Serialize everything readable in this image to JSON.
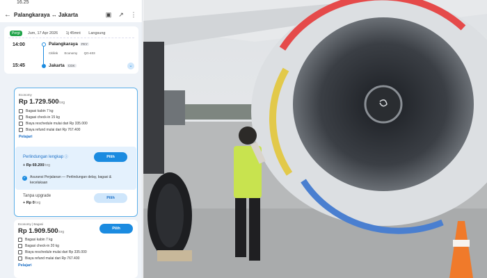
{
  "status": {
    "time": "16.25"
  },
  "header": {
    "title": "Palangkaraya ↔ Jakarta"
  },
  "flight": {
    "tag": "Pergi",
    "date": "Jum, 17 Apr 2026",
    "duration": "1j 45mnt",
    "type": "Langsung",
    "depart_time": "14:00",
    "depart_city": "Palangkaraya",
    "depart_code": "PKY",
    "airline": "Citilink",
    "class": "Economy",
    "flight_no": "QG-403",
    "arrive_time": "15:45",
    "arrive_city": "Jakarta",
    "arrive_code": "CGK"
  },
  "offers": [
    {
      "type": "Economy",
      "price": "Rp 1.729.500",
      "unit": "/org",
      "features": [
        "Bagasi kabin 7 kg",
        "Bagasi check-in 15 kg",
        "Biaya reschedule mulai dari Rp 335.000",
        "Biaya refund mulai dari Rp 767.400"
      ],
      "learn": "Pelajari",
      "protection": {
        "title": "Perlindungan lengkap",
        "price": "+ Rp 69.200",
        "unit": "/org",
        "button": "Pilih",
        "desc": "Asuransi Perjalanan — Perlindungan delay, bagasi & kecelakaan"
      },
      "no_upgrade": {
        "title": "Tanpa upgrade",
        "price": "+ Rp 0",
        "unit": "/org",
        "button": "Pilih"
      }
    },
    {
      "type": "Economy | Bagasi",
      "price": "Rp 1.909.500",
      "unit": "/org",
      "button": "Pilih",
      "features": [
        "Bagasi kabin 7 kg",
        "Bagasi check-in 20 kg",
        "Biaya reschedule mulai dari Rp 335.000",
        "Biaya refund mulai dari Rp 767.400"
      ],
      "learn": "Pelajari"
    }
  ],
  "icons": [
    "back-arrow-icon",
    "save-icon",
    "share-icon",
    "more-icon",
    "chevron-down-icon",
    "info-icon",
    "check-icon",
    "luggage-icon"
  ],
  "colors": {
    "accent": "#1b8be0",
    "tag": "#21a44a",
    "photo_sky": "#e6e8ea"
  }
}
